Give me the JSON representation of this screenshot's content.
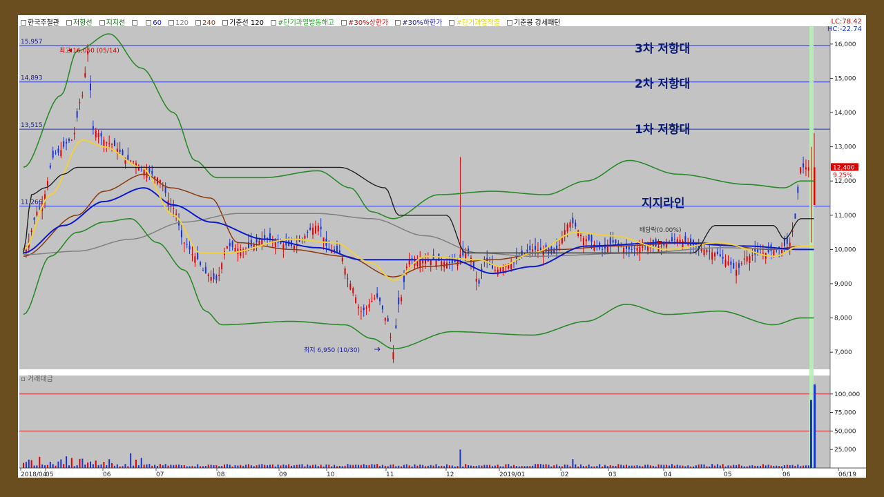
{
  "legend": {
    "items": [
      {
        "label": "한국주철관",
        "color": "#000000"
      },
      {
        "label": "저항선",
        "color": "#006400"
      },
      {
        "label": "지지선",
        "color": "#006400"
      },
      {
        "label": "",
        "color": "#000000"
      },
      {
        "label": "60",
        "color": "#1a1acc"
      },
      {
        "label": "120",
        "color": "#808080"
      },
      {
        "label": "240",
        "color": "#8b3a0f"
      },
      {
        "label": "기준선 120",
        "color": "#000000"
      },
      {
        "label": "#단기과열발동해고",
        "color": "#22aa22"
      },
      {
        "label": "#30%상한가",
        "color": "#e00000"
      },
      {
        "label": "#30%하한가",
        "color": "#1a1acc"
      },
      {
        "label": "#단기과열적출",
        "color": "#dddd00"
      },
      {
        "label": "기준봉 강세패턴",
        "color": "#000000"
      }
    ]
  },
  "lc_label": "LC:78.42",
  "hc_label": "HC:-22.74",
  "volume_title": "거래대금",
  "annotations": {
    "r3": "3차 저항대",
    "r2": "2차 저항대",
    "r1": "1차 저항대",
    "support": "지지라인"
  },
  "chart_data": {
    "type": "candlestick",
    "x_labels": [
      "2018/04",
      "05",
      "06",
      "07",
      "08",
      "09",
      "10",
      "11",
      "12",
      "2019/01",
      "02",
      "03",
      "04",
      "05",
      "06",
      "06/19"
    ],
    "y_ticks": [
      "16,000",
      "15,000",
      "14,000",
      "13,000",
      "12,000",
      "11,000",
      "10,000",
      "9,000",
      "8,000",
      "7,000"
    ],
    "ylim": [
      6500,
      16400
    ],
    "volume_ticks": [
      "100,000",
      "75,000",
      "50,000",
      "25,000"
    ],
    "volume_ylim": [
      0,
      125000
    ],
    "h_lines": [
      {
        "label": "15,957",
        "value": 15957
      },
      {
        "label": "14,893",
        "value": 14893
      },
      {
        "label": "13,515",
        "value": 13515
      },
      {
        "label": "11,266",
        "value": 11266
      }
    ],
    "volume_h_lines": [
      100000,
      50000
    ],
    "high_label": "최고 16,050 (05/14)",
    "low_label": "최저 6,950 (10/30)",
    "dividend_label": "배당락(0.00%)",
    "current_price": "12,400",
    "current_pct": "9.25%",
    "colors": {
      "up": "#e00000",
      "down": "#1a33cc",
      "resist": "#2a8a2a",
      "bench": "#222222",
      "ma20": "#f0d040",
      "ma60": "#0b1bcc",
      "ma120": "#808080",
      "ma240": "#8b3a0f",
      "hline": "#2233cc"
    }
  }
}
